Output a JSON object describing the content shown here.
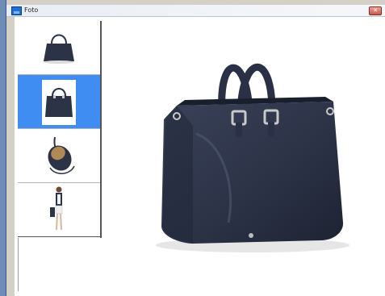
{
  "window": {
    "title": "Foto",
    "close_label": "✕"
  },
  "thumbnails": [
    {
      "name": "bag-front",
      "selected": false
    },
    {
      "name": "bag-angle",
      "selected": true
    },
    {
      "name": "bag-interior",
      "selected": false
    },
    {
      "name": "model-with-bag",
      "selected": false
    }
  ],
  "colors": {
    "desktop": "#6f8cb7",
    "selection": "#3f8cf2",
    "bag": "#2c3347"
  }
}
